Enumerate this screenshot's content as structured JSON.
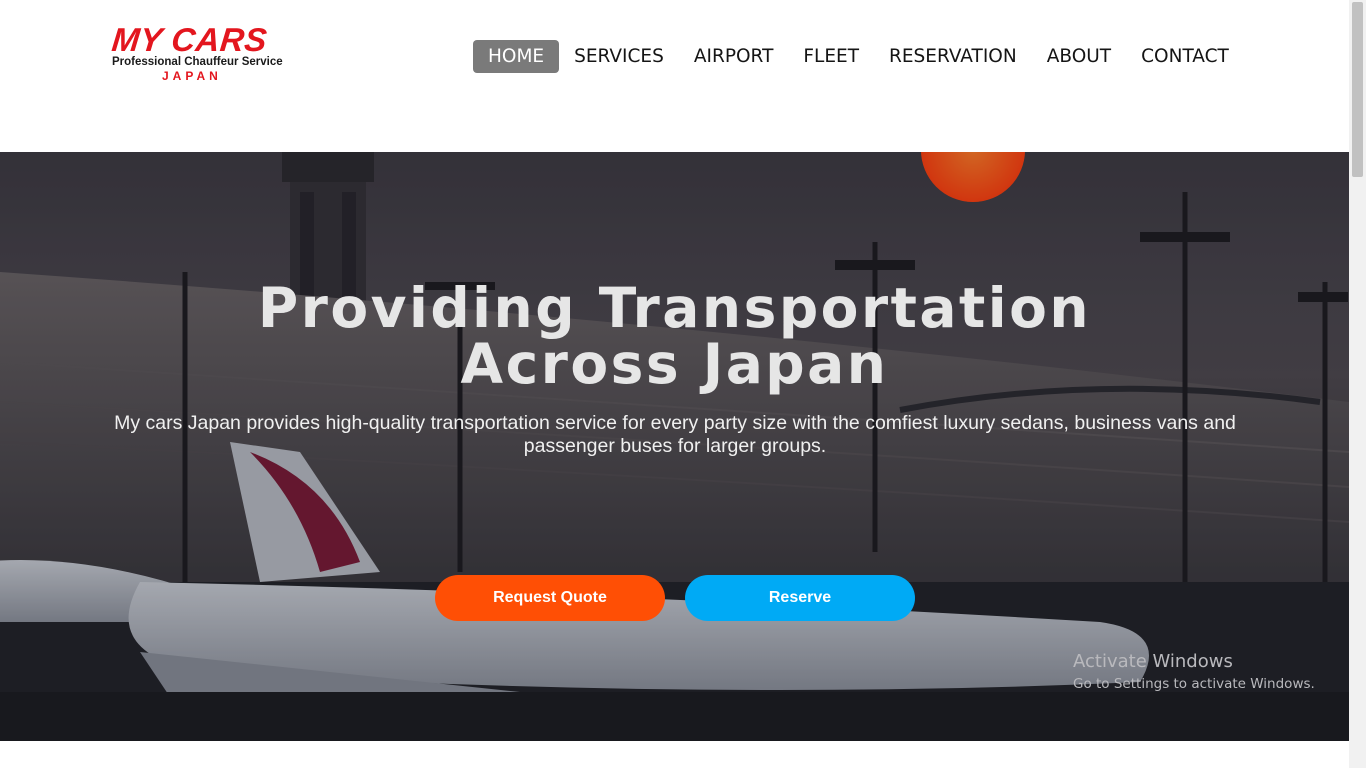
{
  "brand": {
    "name": "MY CARS",
    "tagline": "Professional Chauffeur Service",
    "country": "JAPAN",
    "color": "#e3161e"
  },
  "nav": {
    "items": [
      {
        "label": "HOME",
        "active": true
      },
      {
        "label": "SERVICES",
        "active": false
      },
      {
        "label": "AIRPORT",
        "active": false
      },
      {
        "label": "FLEET",
        "active": false
      },
      {
        "label": "RESERVATION",
        "active": false
      },
      {
        "label": "ABOUT",
        "active": false
      },
      {
        "label": "CONTACT",
        "active": false
      }
    ]
  },
  "hero": {
    "title_line1": "Providing Transportation",
    "title_line2": "Across Japan",
    "subtitle": "My cars Japan provides high-quality transportation service for every party size with the comfiest luxury sedans, business vans and passenger buses for larger groups.",
    "quote_button": "Request Quote",
    "reserve_button": "Reserve",
    "quote_color": "#ff4f05",
    "reserve_color": "#00aaf5"
  },
  "watermark": {
    "line1": "Activate Windows",
    "line2": "Go to Settings to activate Windows."
  }
}
